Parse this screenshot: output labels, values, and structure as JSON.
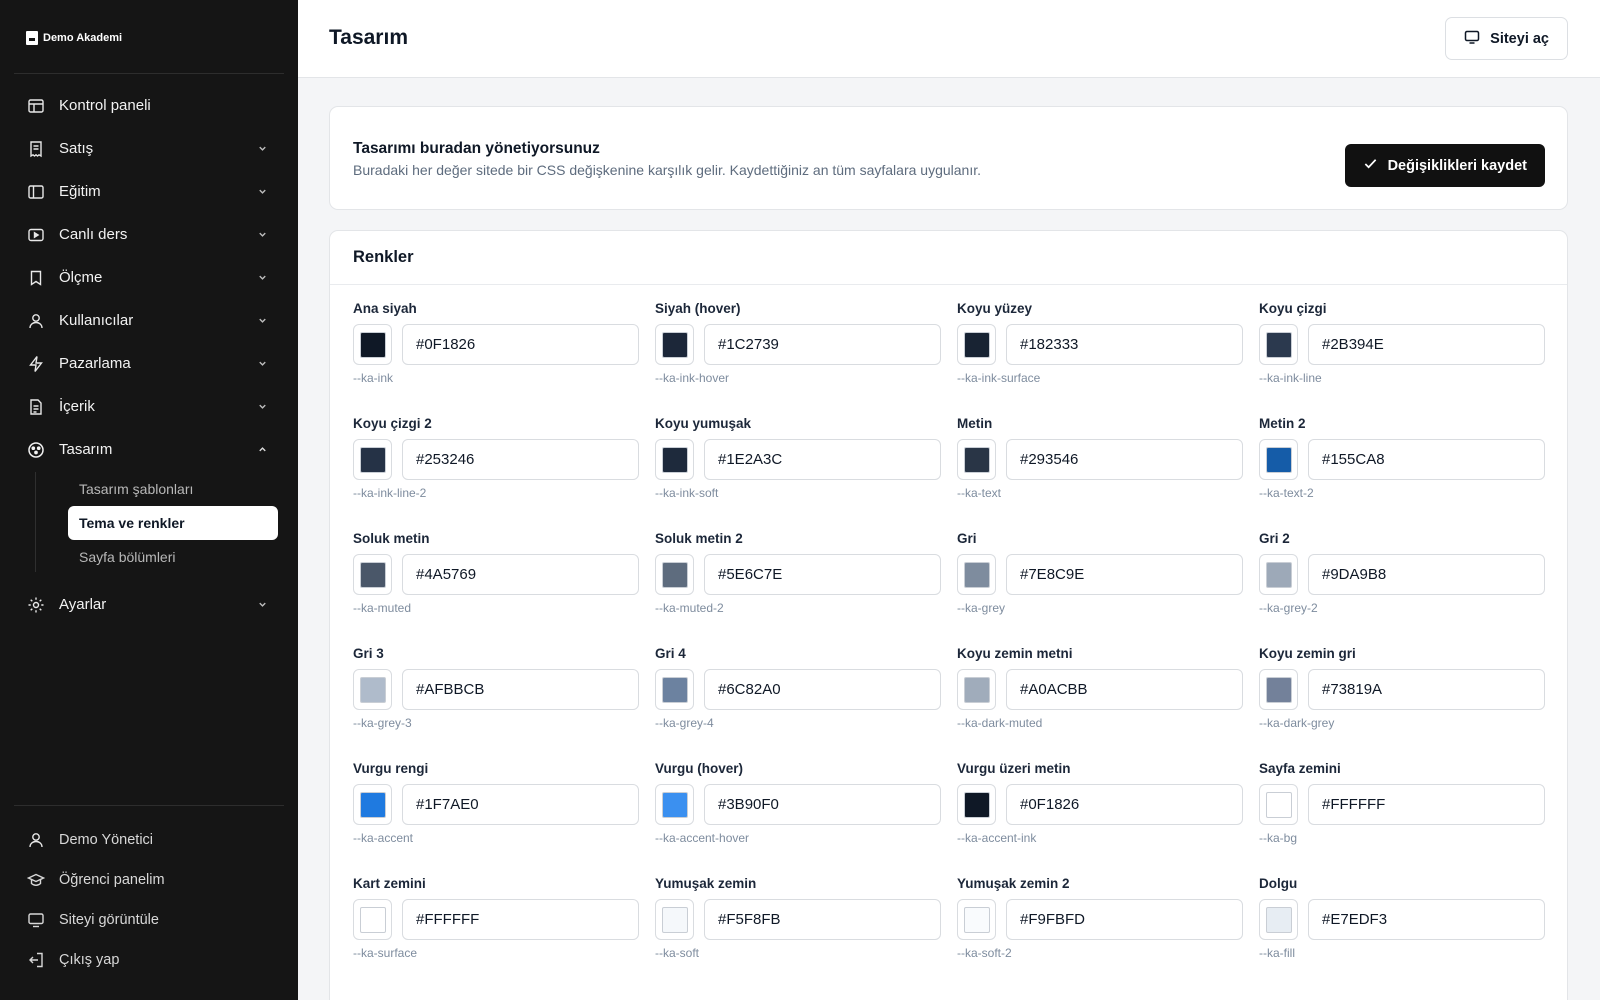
{
  "brand": {
    "name": "Demo Akademi"
  },
  "sidebar": {
    "items": [
      {
        "label": "Kontrol paneli",
        "icon": "dashboard-icon",
        "name": "kontrol-paneli",
        "chevron": ""
      },
      {
        "label": "Satış",
        "icon": "receipt-icon",
        "name": "satis",
        "chevron": "down"
      },
      {
        "label": "Eğitim",
        "icon": "book-icon",
        "name": "egitim",
        "chevron": "down"
      },
      {
        "label": "Canlı ders",
        "icon": "video-icon",
        "name": "canli-ders",
        "chevron": "down"
      },
      {
        "label": "Ölçme",
        "icon": "bookmark-icon",
        "name": "olcme",
        "chevron": "down"
      },
      {
        "label": "Kullanıcılar",
        "icon": "user-icon",
        "name": "kullanicilar",
        "chevron": "down"
      },
      {
        "label": "Pazarlama",
        "icon": "bolt-icon",
        "name": "pazarlama",
        "chevron": "down"
      },
      {
        "label": "İçerik",
        "icon": "document-icon",
        "name": "icerik",
        "chevron": "down"
      },
      {
        "label": "Tasarım",
        "icon": "palette-icon",
        "name": "tasarim",
        "chevron": "up"
      }
    ],
    "subitems": [
      {
        "label": "Tasarım şablonları",
        "active": false
      },
      {
        "label": "Tema ve renkler",
        "active": true
      },
      {
        "label": "Sayfa bölümleri",
        "active": false
      }
    ],
    "settings": {
      "label": "Ayarlar",
      "icon": "gear-icon"
    },
    "bottom": [
      {
        "label": "Demo Yönetici",
        "icon": "user-icon"
      },
      {
        "label": "Öğrenci panelim",
        "icon": "graduation-cap-icon"
      },
      {
        "label": "Siteyi görüntüle",
        "icon": "monitor-icon"
      },
      {
        "label": "Çıkış yap",
        "icon": "logout-icon"
      }
    ]
  },
  "header": {
    "title": "Tasarım",
    "open_site_label": "Siteyi aç"
  },
  "info": {
    "title": "Tasarımı buradan yönetiyorsunuz",
    "description": "Buradaki her değer sitede bir CSS değişkenine karşılık gelir. Kaydettiğiniz an tüm sayfalara uygulanır.",
    "save_label": "Değişiklikleri kaydet"
  },
  "colors": {
    "title": "Renkler",
    "fields": [
      {
        "label": "Ana siyah",
        "value": "#0F1826",
        "var": "--ka-ink"
      },
      {
        "label": "Siyah (hover)",
        "value": "#1C2739",
        "var": "--ka-ink-hover"
      },
      {
        "label": "Koyu yüzey",
        "value": "#182333",
        "var": "--ka-ink-surface"
      },
      {
        "label": "Koyu çizgi",
        "value": "#2B394E",
        "var": "--ka-ink-line"
      },
      {
        "label": "Koyu çizgi 2",
        "value": "#253246",
        "var": "--ka-ink-line-2"
      },
      {
        "label": "Koyu yumuşak",
        "value": "#1E2A3C",
        "var": "--ka-ink-soft"
      },
      {
        "label": "Metin",
        "value": "#293546",
        "var": "--ka-text"
      },
      {
        "label": "Metin 2",
        "value": "#155CA8",
        "var": "--ka-text-2"
      },
      {
        "label": "Soluk metin",
        "value": "#4A5769",
        "var": "--ka-muted"
      },
      {
        "label": "Soluk metin 2",
        "value": "#5E6C7E",
        "var": "--ka-muted-2"
      },
      {
        "label": "Gri",
        "value": "#7E8C9E",
        "var": "--ka-grey"
      },
      {
        "label": "Gri 2",
        "value": "#9DA9B8",
        "var": "--ka-grey-2"
      },
      {
        "label": "Gri 3",
        "value": "#AFBBCB",
        "var": "--ka-grey-3"
      },
      {
        "label": "Gri 4",
        "value": "#6C82A0",
        "var": "--ka-grey-4"
      },
      {
        "label": "Koyu zemin metni",
        "value": "#A0ACBB",
        "var": "--ka-dark-muted"
      },
      {
        "label": "Koyu zemin gri",
        "value": "#73819A",
        "var": "--ka-dark-grey"
      },
      {
        "label": "Vurgu rengi",
        "value": "#1F7AE0",
        "var": "--ka-accent"
      },
      {
        "label": "Vurgu (hover)",
        "value": "#3B90F0",
        "var": "--ka-accent-hover"
      },
      {
        "label": "Vurgu üzeri metin",
        "value": "#0F1826",
        "var": "--ka-accent-ink"
      },
      {
        "label": "Sayfa zemini",
        "value": "#FFFFFF",
        "var": "--ka-bg"
      },
      {
        "label": "Kart zemini",
        "value": "#FFFFFF",
        "var": "--ka-surface"
      },
      {
        "label": "Yumuşak zemin",
        "value": "#F5F8FB",
        "var": "--ka-soft"
      },
      {
        "label": "Yumuşak zemin 2",
        "value": "#F9FBFD",
        "var": "--ka-soft-2"
      },
      {
        "label": "Dolgu",
        "value": "#E7EDF3",
        "var": "--ka-fill"
      }
    ]
  }
}
